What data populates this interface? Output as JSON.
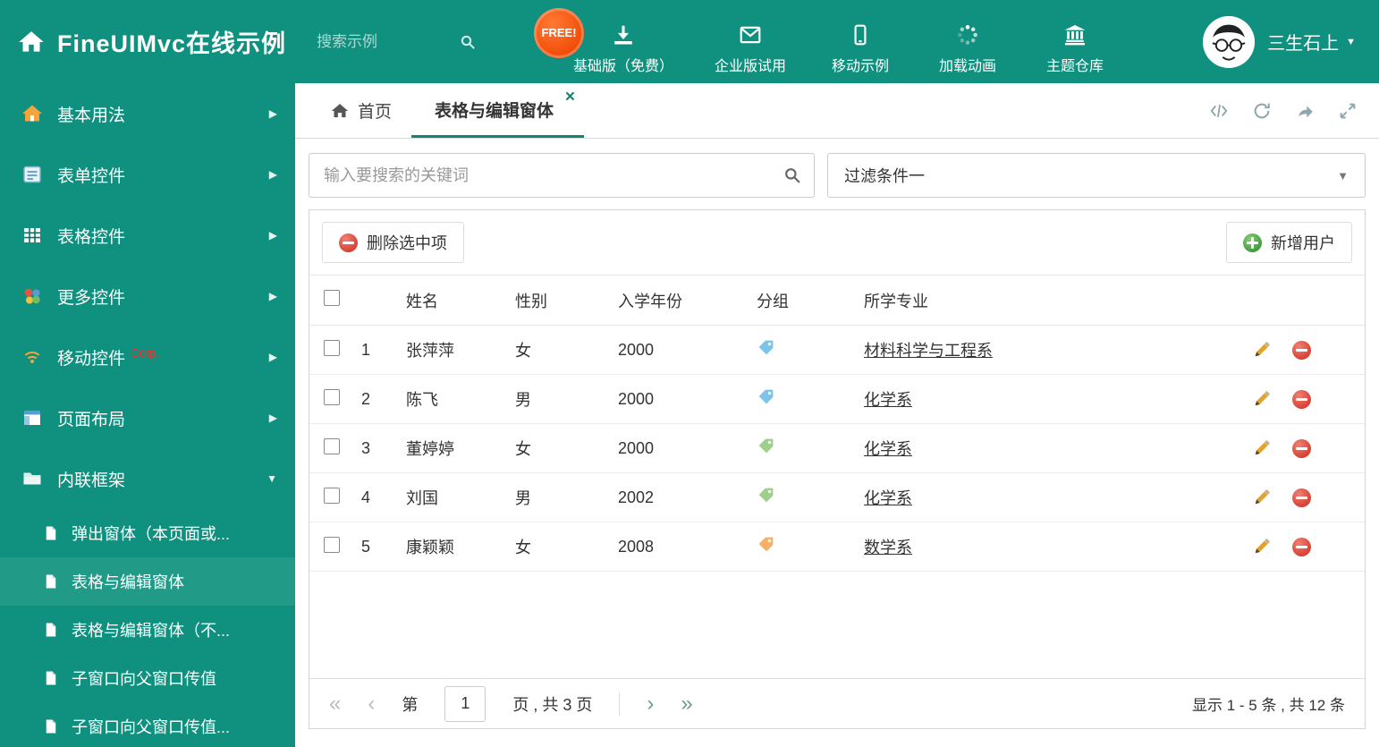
{
  "header": {
    "title": "FineUIMvc在线示例",
    "search_placeholder": "搜索示例",
    "free_badge": "FREE!",
    "nav": [
      {
        "label": "基础版（免费）"
      },
      {
        "label": "企业版试用"
      },
      {
        "label": "移动示例"
      },
      {
        "label": "加载动画"
      },
      {
        "label": "主题仓库"
      }
    ],
    "user_name": "三生石上"
  },
  "sidebar": {
    "items": [
      {
        "label": "基本用法"
      },
      {
        "label": "表单控件"
      },
      {
        "label": "表格控件"
      },
      {
        "label": "更多控件"
      },
      {
        "label": "移动控件",
        "badge": "Corp."
      },
      {
        "label": "页面布局"
      },
      {
        "label": "内联框架"
      }
    ],
    "subitems": [
      {
        "label": "弹出窗体（本页面或..."
      },
      {
        "label": "表格与编辑窗体"
      },
      {
        "label": "表格与编辑窗体（不..."
      },
      {
        "label": "子窗口向父窗口传值"
      },
      {
        "label": "子窗口向父窗口传值..."
      }
    ]
  },
  "tabs": {
    "home_label": "首页",
    "active_label": "表格与编辑窗体"
  },
  "filter": {
    "search_placeholder": "输入要搜索的关键词",
    "dropdown_value": "过滤条件一"
  },
  "toolbar": {
    "delete_label": "删除选中项",
    "add_label": "新增用户"
  },
  "table": {
    "headers": {
      "name": "姓名",
      "gender": "性别",
      "year": "入学年份",
      "group": "分组",
      "major": "所学专业"
    },
    "rows": [
      {
        "num": "1",
        "name": "张萍萍",
        "gender": "女",
        "year": "2000",
        "tag_color": "#7ec3ea",
        "major": "材料科学与工程系"
      },
      {
        "num": "2",
        "name": "陈飞",
        "gender": "男",
        "year": "2000",
        "tag_color": "#7ec3ea",
        "major": "化学系"
      },
      {
        "num": "3",
        "name": "董婷婷",
        "gender": "女",
        "year": "2000",
        "tag_color": "#9ed08c",
        "major": "化学系"
      },
      {
        "num": "4",
        "name": "刘国",
        "gender": "男",
        "year": "2002",
        "tag_color": "#9ed08c",
        "major": "化学系"
      },
      {
        "num": "5",
        "name": "康颖颖",
        "gender": "女",
        "year": "2008",
        "tag_color": "#f5b06a",
        "major": "数学系"
      }
    ]
  },
  "pagination": {
    "label_page": "第",
    "current_page": "1",
    "label_total": "页 , 共 3 页",
    "summary": "显示 1 - 5 条 , 共 12 条"
  },
  "icons": {
    "chevron_right": "▶",
    "chevron_down": "▼",
    "caret_down": "▼",
    "close": "×",
    "first": "«",
    "prev": "‹",
    "next": "›",
    "last": "»"
  }
}
